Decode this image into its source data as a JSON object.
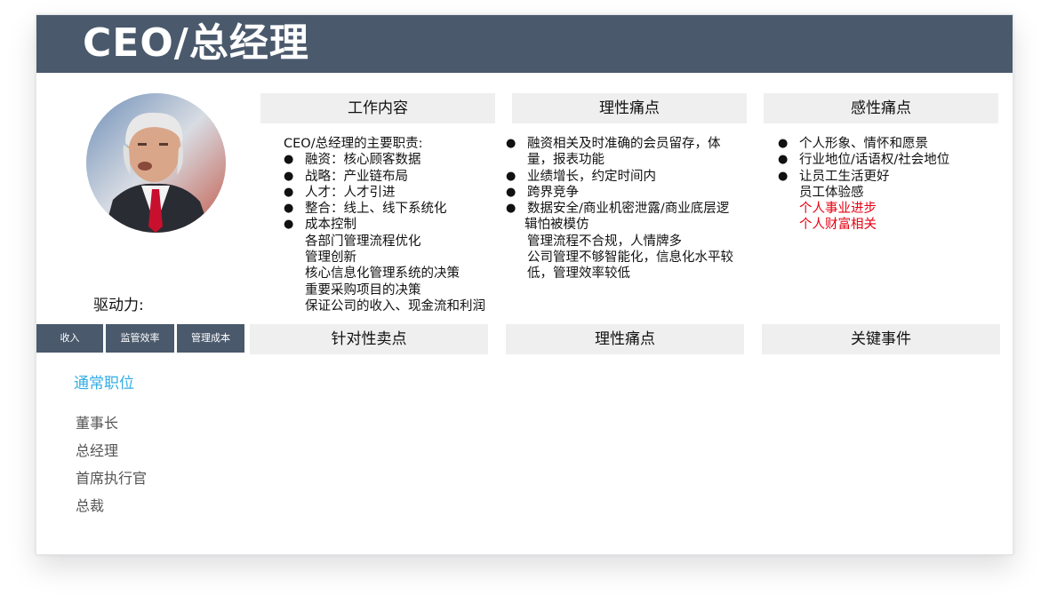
{
  "title": "CEO/总经理",
  "columns_top": [
    {
      "header": "工作内容"
    },
    {
      "header": "理性痛点"
    },
    {
      "header": "感性痛点"
    }
  ],
  "work_content": {
    "intro": "CEO/总经理的主要职责:",
    "items": [
      "融资：核心顾客数据",
      "战略：产业链布局",
      "人才：人才引进",
      "整合：线上、线下系统化",
      "成本控制"
    ],
    "sub_items": [
      "各部门管理流程优化",
      "管理创新",
      "核心信息化管理系统的决策",
      "重要采购项目的决策",
      "保证公司的收入、现金流和利润"
    ]
  },
  "rational_pain": {
    "lines": [
      {
        "bullet": true,
        "text": "融资相关及时准确的会员留存，体"
      },
      {
        "bullet": false,
        "text": "量，报表功能"
      },
      {
        "bullet": true,
        "text": "业绩增长，约定时间内"
      },
      {
        "bullet": true,
        "text": "跨界竞争"
      },
      {
        "bullet": true,
        "text": "数据安全/商业机密泄露/商业底层逻"
      },
      {
        "bullet": false,
        "text": "辑怕被模仿"
      },
      {
        "bullet": false,
        "text": "管理流程不合规，人情牌多"
      },
      {
        "bullet": false,
        "text": "公司管理不够智能化，信息化水平较"
      },
      {
        "bullet": false,
        "text": "低，管理效率较低"
      }
    ]
  },
  "emotional_pain": {
    "items": [
      "个人形象、情怀和愿景",
      "行业地位/话语权/社会地位",
      "让员工生活更好"
    ],
    "plain": "员工体验感",
    "highlighted": [
      "个人事业进步",
      "个人财富相关"
    ],
    "highlight_color": "#e60012"
  },
  "drive_label": "驱动力:",
  "drive_tags": [
    "收入",
    "监管效率",
    "管理成本"
  ],
  "columns_bottom": [
    {
      "header": "针对性卖点"
    },
    {
      "header": "理性痛点"
    },
    {
      "header": "关键事件"
    }
  ],
  "roles": {
    "title": "通常职位",
    "items": [
      "董事长",
      "总经理",
      "首席执行官",
      "总裁"
    ]
  },
  "colors": {
    "title_bar": "#4a596c",
    "header_bg": "#efefef",
    "roles_title": "#33aee5"
  }
}
